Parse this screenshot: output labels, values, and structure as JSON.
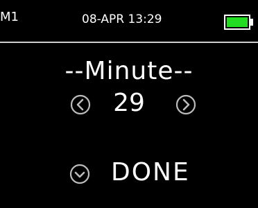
{
  "status": {
    "mode": "M1",
    "datetime": "08-APR 13:29",
    "battery_level": 1.0,
    "battery_color": "#22dd22"
  },
  "editor": {
    "title": "--Minute--",
    "value": "29",
    "decrease_icon": "chevron-left-icon",
    "increase_icon": "chevron-right-icon"
  },
  "actions": {
    "done_label": "DONE",
    "done_icon": "chevron-down-icon"
  }
}
